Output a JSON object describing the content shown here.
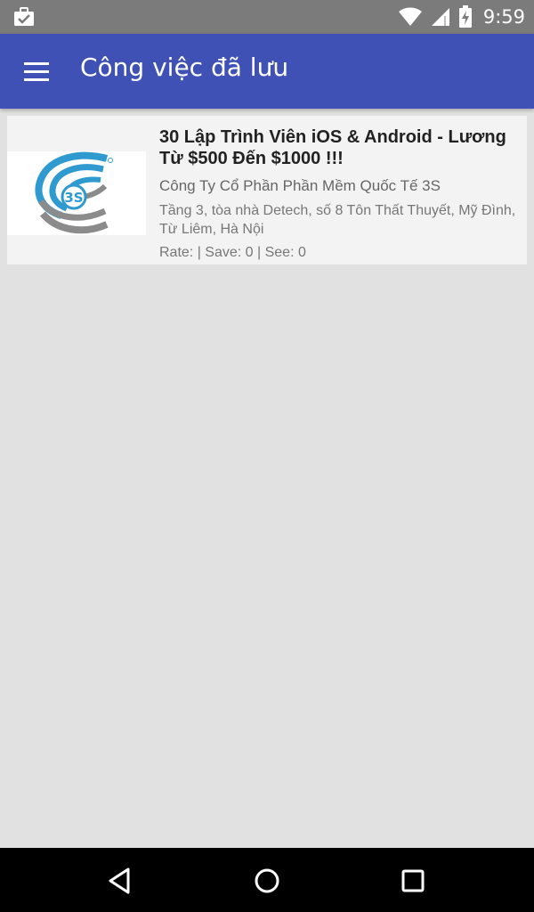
{
  "status_bar": {
    "time": "9:59",
    "icons": [
      "briefcase-check-icon",
      "wifi-icon",
      "cell-signal-icon",
      "battery-charging-icon"
    ]
  },
  "app_bar": {
    "title": "Công việc đã lưu",
    "menu_icon": "hamburger-menu-icon",
    "color": "#3f51b5"
  },
  "saved_jobs": [
    {
      "logo": "3S company logo",
      "logo_text": "3S",
      "title": "30 Lập Trình Viên iOS & Android - Lương Từ $500 Đến $1000 !!!",
      "company": "Công Ty Cổ Phần Phần Mềm Quốc Tế 3S",
      "address": "Tầng 3, tòa nhà Detech, số 8 Tôn Thất Thuyết, Mỹ Đình, Từ Liêm, Hà Nội",
      "meta": "Rate:  | Save: 0 | See: 0"
    }
  ],
  "nav_bar": {
    "buttons": [
      "back-icon",
      "home-icon",
      "recent-apps-icon"
    ]
  },
  "colors": {
    "status_bar": "#7b7b7b",
    "background": "#e1e1e1",
    "card": "#f3f3f3",
    "logo_blue": "#2f9ad0",
    "logo_gray": "#8b8b8b"
  }
}
